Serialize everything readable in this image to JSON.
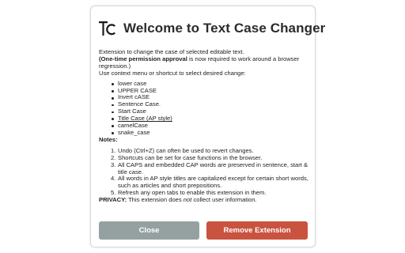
{
  "header": {
    "logo_text": "TC",
    "title": "Welcome to Text Case Changer"
  },
  "intro": {
    "line1": "Extension to change the case of selected editable text.",
    "permission_bold": "(One-time permission approval",
    "permission_rest": " is now required to work around a browser regression.)",
    "usage": "Use context menu or shortcut to select desired change:"
  },
  "changes": [
    {
      "label": "lower case"
    },
    {
      "label": "UPPER CASE"
    },
    {
      "label": "Invert cASE"
    },
    {
      "label": "Sentence Case."
    },
    {
      "label": "Start Case"
    },
    {
      "label": "Title Case (AP style)"
    },
    {
      "label": "camelCase"
    },
    {
      "label": "snake_case"
    }
  ],
  "notes": {
    "heading": "Notes:",
    "items": [
      {
        "num": "1.",
        "text": "Undo (Ctrl+Z) can often be used to revert changes."
      },
      {
        "num": "2.",
        "text": "Shortcuts can be set for case functions in the browser."
      },
      {
        "num": "3.",
        "text": "All CAPS and embedded CAP words are preserved in sentence, start & title case."
      },
      {
        "num": "4.",
        "text": "All words in AP style titles are capitalized except for certain short words, such as articles and short prepositions."
      },
      {
        "num": "5.",
        "text": "Refresh any open tabs to enable this extension in them."
      }
    ]
  },
  "privacy": {
    "label": "PRIVACY:",
    "pre": " This extension does ",
    "emph": "not",
    "post": " collect user information."
  },
  "buttons": {
    "close_label": "Close",
    "remove_label": "Remove Extension"
  },
  "colors": {
    "close_button": "#94a1a0",
    "remove_button": "#c9533f"
  }
}
